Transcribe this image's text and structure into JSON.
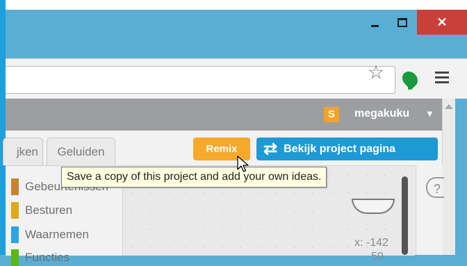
{
  "window": {
    "close_glyph": "✕"
  },
  "browser": {
    "star_glyph": "☆"
  },
  "scratch": {
    "username": "megakuku",
    "username_caret": "▼",
    "user_icon_letter": "S"
  },
  "tabs": [
    {
      "label": "jken"
    },
    {
      "label": "Geluiden"
    }
  ],
  "buttons": {
    "remix": "Remix",
    "project_page": "Bekijk project pagina",
    "project_page_icon": "⇄"
  },
  "categories": [
    {
      "label": "Gebeurtenissen",
      "color": "#c88330"
    },
    {
      "label": "Besturen",
      "color": "#e1a91a"
    },
    {
      "label": "Waarnemen",
      "color": "#2ca5e2"
    },
    {
      "label": "Functies",
      "color": "#5cb712"
    }
  ],
  "tooltip": "Save a copy of this project and add your own ideas.",
  "help_glyph": "?",
  "stage": {
    "x_readout": "x: -142",
    "y_readout": "50"
  },
  "colors": {
    "accent_orange": "#f7a92b",
    "accent_blue": "#1d9ad6",
    "window_close": "#c9403a",
    "window_frame": "#59aed4"
  }
}
